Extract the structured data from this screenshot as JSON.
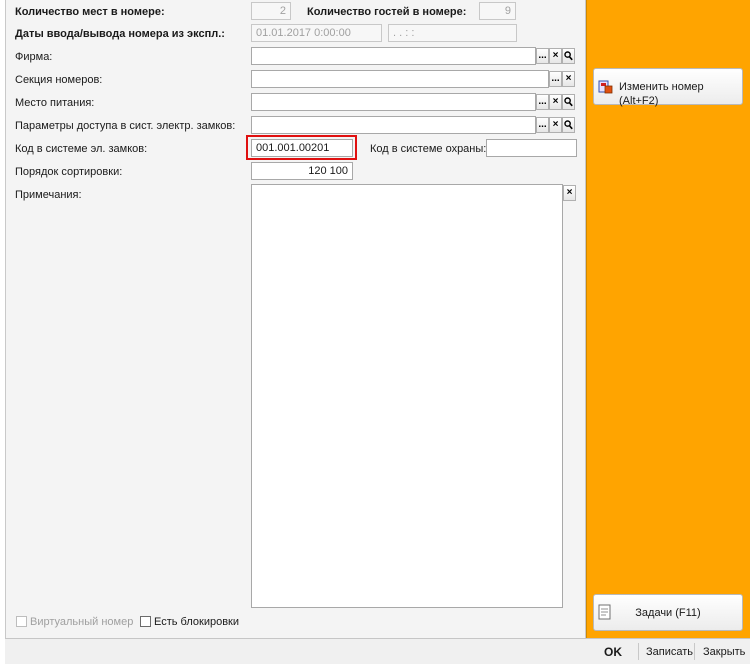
{
  "form": {
    "places_label": "Количество мест в номере:",
    "places_value": "2",
    "guests_label": "Количество гостей в номере:",
    "guests_value": "9",
    "dates_label": "Даты ввода/вывода номера из экспл.:",
    "date_in": "01.01.2017  0:00:00",
    "date_out": " .  .      :  :",
    "firm_label": "Фирма:",
    "firm_value": "",
    "section_label": "Секция номеров:",
    "section_value": "",
    "meal_label": "Место питания:",
    "meal_value": "",
    "access_label": "Параметры доступа в сист. электр. замков:",
    "access_value": "",
    "lock_code_label": "Код в системе эл. замков:",
    "lock_code_value": "001.001.00201",
    "security_code_label": "Код в системе охраны:",
    "security_code_value": "",
    "sort_label": "Порядок сортировки:",
    "sort_value": "120 100",
    "notes_label": "Примечания:",
    "notes_value": "",
    "virtual_label": "Виртуальный номер",
    "blocks_label": "Есть блокировки"
  },
  "buttons": {
    "select": "...",
    "clear": "×"
  },
  "sidebar": {
    "change_room": "Изменить номер (Alt+F2)",
    "tasks": "Задачи (F11)"
  },
  "footer": {
    "ok": "OK",
    "save": "Записать",
    "close": "Закрыть"
  },
  "colors": {
    "sidebar_bg": "#ffa400",
    "highlight": "#e01010"
  },
  "icons": [
    "select-icon",
    "clear-icon",
    "search-icon",
    "room-edit-icon",
    "tasks-icon"
  ]
}
